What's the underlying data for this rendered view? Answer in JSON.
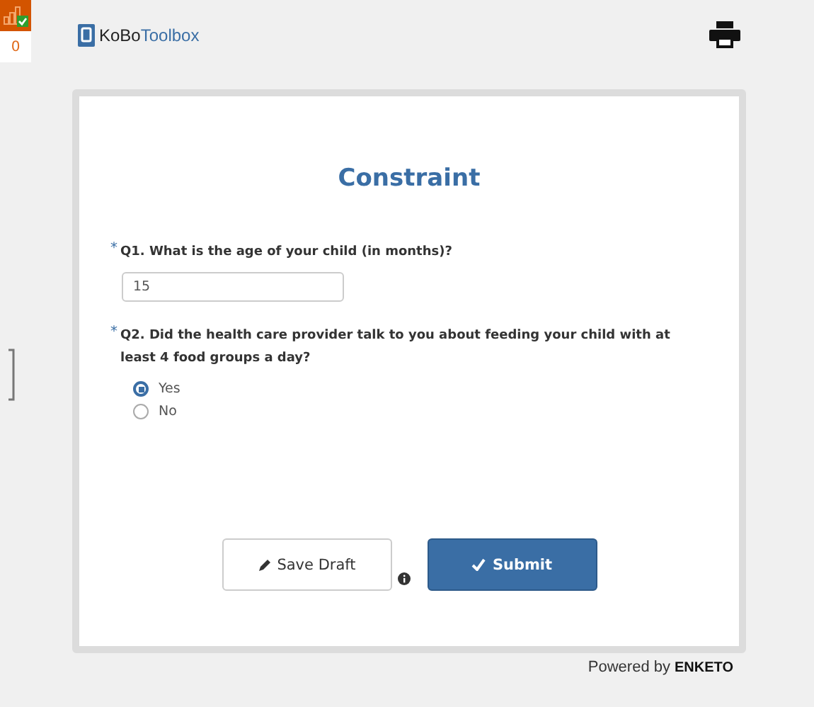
{
  "queue": {
    "count": "0"
  },
  "header": {
    "logo_primary": "KoBo",
    "logo_secondary": "Toolbox"
  },
  "form": {
    "title": "Constraint",
    "questions": [
      {
        "kind": "text",
        "required_mark": "*",
        "label": "Q1. What is the age of your child (in months)?",
        "value": "15"
      },
      {
        "kind": "radio",
        "required_mark": "*",
        "label": "Q2. Did the health care provider talk to you about feeding your child with at least 4 food groups a day?",
        "options": [
          {
            "label": "Yes",
            "selected": true
          },
          {
            "label": "No",
            "selected": false
          }
        ]
      }
    ],
    "buttons": {
      "save": "Save Draft",
      "submit": "Submit"
    }
  },
  "footer": {
    "powered_by": "Powered by",
    "brand": "ENKETO"
  }
}
